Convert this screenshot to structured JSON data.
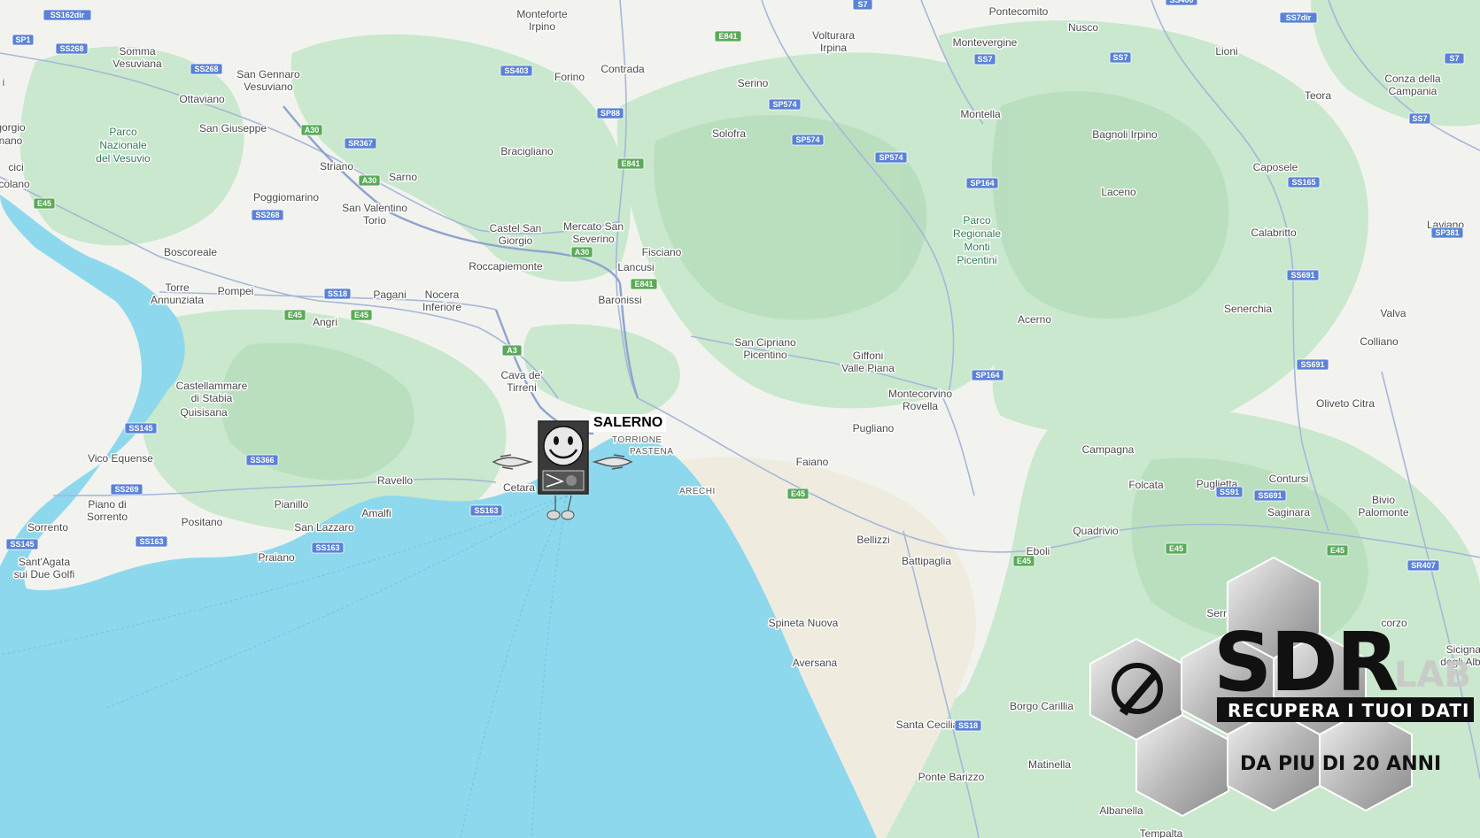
{
  "map": {
    "colors": {
      "sea": "#8ed8ee",
      "land": "#f2f3ee",
      "forest": "#c9e8cd",
      "forest_dark": "#b4dcbc",
      "plain": "#eeebde",
      "road": "#9fb0d6",
      "road_major": "#8ca0cc",
      "shield_blue": "#5b82d6",
      "shield_green": "#5aaa5a"
    },
    "marked_city": "SALERNO",
    "places": [
      {
        "name": "Monteforte",
        "line2": "Irpino"
      },
      {
        "name": "Pontecomito"
      },
      {
        "name": "Nusco"
      },
      {
        "name": "Volturara",
        "line2": "Irpina"
      },
      {
        "name": "Montevergine"
      },
      {
        "name": "Lioni"
      },
      {
        "name": "Somma",
        "line2": "Vesuviana"
      },
      {
        "name": "San Gennaro",
        "line2": "Vesuviano"
      },
      {
        "name": "Contrada"
      },
      {
        "name": "Forino"
      },
      {
        "name": "Serino"
      },
      {
        "name": "Conza della",
        "line2": "Campania"
      },
      {
        "name": "Ottaviano"
      },
      {
        "name": "Teora"
      },
      {
        "name": "Montella"
      },
      {
        "name": "San Giuseppe"
      },
      {
        "name": "Solofra"
      },
      {
        "name": "Bagnoli Irpino"
      },
      {
        "name": "Bracigliano"
      },
      {
        "name": "Striano"
      },
      {
        "name": "Sarno"
      },
      {
        "name": "Caposele"
      },
      {
        "name": "Poggiomarino"
      },
      {
        "name": "San Valentino",
        "line2": "Torio"
      },
      {
        "name": "Laceno"
      },
      {
        "name": "Castel San",
        "line2": "Giorgio"
      },
      {
        "name": "Mercato San",
        "line2": "Severino"
      },
      {
        "name": "Calabritto"
      },
      {
        "name": "Laviano"
      },
      {
        "name": "Boscoreale"
      },
      {
        "name": "Fisciano"
      },
      {
        "name": "Roccapiemonte"
      },
      {
        "name": "Lancusi"
      },
      {
        "name": "Torre",
        "line2": "Annunziata"
      },
      {
        "name": "Pompei"
      },
      {
        "name": "Pagani"
      },
      {
        "name": "Nocera",
        "line2": "Inferiore"
      },
      {
        "name": "Baronissi"
      },
      {
        "name": "Senerchia"
      },
      {
        "name": "Angri"
      },
      {
        "name": "Valva"
      },
      {
        "name": "Acerno"
      },
      {
        "name": "San Cipriano",
        "line2": "Picentino"
      },
      {
        "name": "Colliano"
      },
      {
        "name": "Giffoni",
        "line2": "Valle Piana"
      },
      {
        "name": "Cava de'",
        "line2": "Tirreni"
      },
      {
        "name": "Castellammare",
        "line2": "di Stabia"
      },
      {
        "name": "Quisisana"
      },
      {
        "name": "Montecorvino",
        "line2": "Rovella"
      },
      {
        "name": "Oliveto Citra"
      },
      {
        "name": "Pugliano"
      },
      {
        "name": "Vico Equense"
      },
      {
        "name": "Campagna"
      },
      {
        "name": "Faiano"
      },
      {
        "name": "Cetara"
      },
      {
        "name": "Ravello"
      },
      {
        "name": "Contursi"
      },
      {
        "name": "Folcata"
      },
      {
        "name": "Puglietta"
      },
      {
        "name": "Sicignano",
        "line2": "degli Alburni"
      },
      {
        "name": "Pianillo"
      },
      {
        "name": "Amalfi"
      },
      {
        "name": "Piano di",
        "line2": "Sorrento"
      },
      {
        "name": "Bivio",
        "line2": "Palomonte"
      },
      {
        "name": "Saginara"
      },
      {
        "name": "Positano"
      },
      {
        "name": "San Lazzaro"
      },
      {
        "name": "Quadrivio"
      },
      {
        "name": "Sorrento"
      },
      {
        "name": "Bellizzi"
      },
      {
        "name": "Eboli"
      },
      {
        "name": "Battipaglia"
      },
      {
        "name": "Sant'Agata",
        "line2": "sui Due Golfi"
      },
      {
        "name": "Praiano"
      },
      {
        "name": "Serre"
      },
      {
        "name": "Spineta Nuova"
      },
      {
        "name": "Aversana"
      },
      {
        "name": "Borgo Carillia"
      },
      {
        "name": "Santa Cecilia"
      },
      {
        "name": "Matinella"
      },
      {
        "name": "Ponte Barizzo"
      },
      {
        "name": "Albanella"
      },
      {
        "name": "Tempalta"
      },
      {
        "name": "corzo"
      },
      {
        "name": "gorgio"
      },
      {
        "name": "nano"
      },
      {
        "name": "cici"
      },
      {
        "name": "colano"
      },
      {
        "name": "i"
      }
    ],
    "districts": [
      "TORRIONE",
      "PASTENA",
      "ARECHI"
    ],
    "parks": [
      {
        "lines": [
          "Parco",
          "Nazionale",
          "del Vesuvio"
        ]
      },
      {
        "lines": [
          "Parco",
          "Regionale",
          "Monti",
          "Picentini"
        ]
      }
    ],
    "shields": [
      "SS162dir",
      "SP1",
      "SS268",
      "SS268",
      "SS268",
      "A30",
      "SR367",
      "A30",
      "E45",
      "SS403",
      "SP88",
      "E841",
      "E841",
      "A30",
      "E841",
      "SS18",
      "E45",
      "E45",
      "A3",
      "SS145",
      "SS366",
      "SS269",
      "SS145",
      "SS163",
      "SS163",
      "SS163",
      "SP574",
      "SP574",
      "SP574",
      "SS7",
      "SS7",
      "SS7dir",
      "SS7",
      "SP164",
      "SP164",
      "SS165",
      "SP381",
      "SS691",
      "SS691",
      "SS91",
      "SS691",
      "E45",
      "E45",
      "E45",
      "E45",
      "SR407",
      "SS18",
      "S7",
      "SS400",
      "S7"
    ]
  },
  "logo": {
    "title": "SDR",
    "lab": "LAB",
    "tagline1": "RECUPERA I TUOI DATI",
    "tagline2": "DA  PIU DI 20 ANNI",
    "colors": {
      "black": "#111111",
      "silver": "#c8c8c8",
      "white": "#ffffff"
    }
  }
}
